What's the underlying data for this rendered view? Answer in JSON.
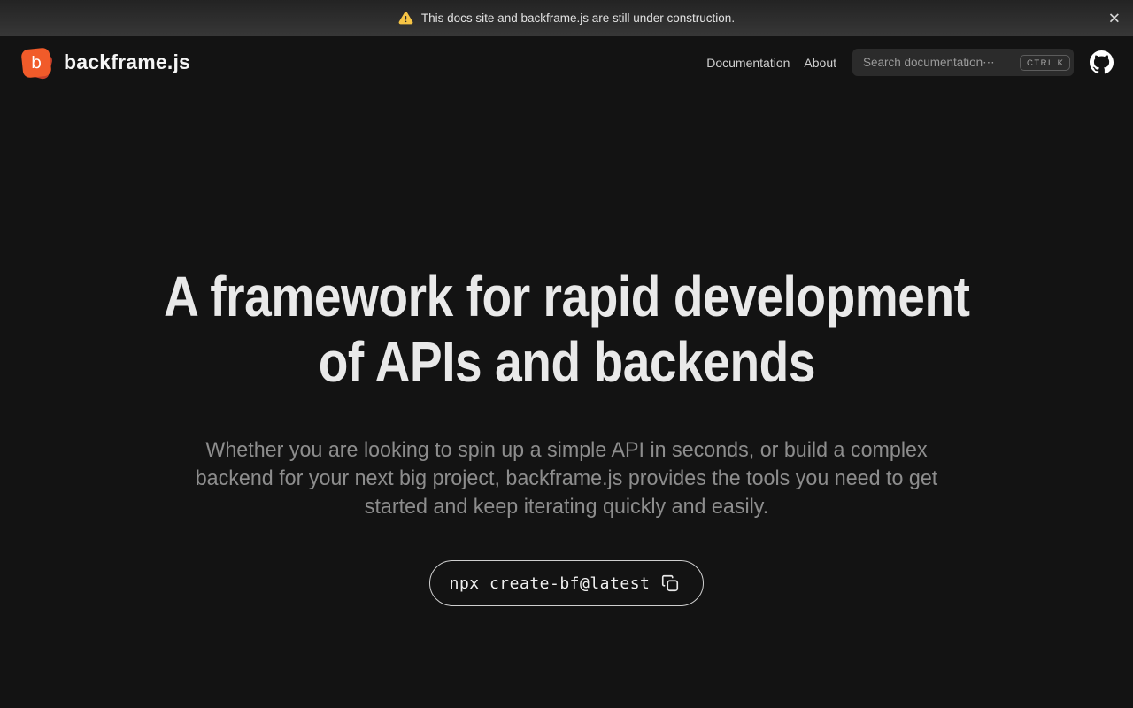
{
  "banner": {
    "text": "This docs site and backframe.js are still under construction.",
    "close_label": "✕"
  },
  "header": {
    "logo_letter": "b",
    "brand": "backframe.js",
    "nav": [
      {
        "label": "Documentation"
      },
      {
        "label": "About"
      }
    ],
    "search": {
      "placeholder": "Search documentation⋯",
      "value": "",
      "shortcut": "CTRL K"
    }
  },
  "hero": {
    "title_line1": "A framework for rapid development",
    "title_line2": "of APIs and backends",
    "subtitle": "Whether you are looking to spin up a simple API in seconds, or build a complex backend for your next big project, backframe.js provides the tools you need to get started and keep iterating quickly and easily.",
    "command": "npx create-bf@latest"
  },
  "icons": {
    "banner_warning": "warning-triangle-icon",
    "banner_close": "close-icon",
    "header_github": "github-icon",
    "command_copy": "copy-icon"
  },
  "colors": {
    "page_background": "#131313",
    "banner_gradient_top": "#232323",
    "banner_gradient_bottom": "#373737",
    "logo_orange": "#f15b2a",
    "logo_dark_orange": "#c8402a",
    "warning_yellow": "#f6c445",
    "heading_text": "#e9e9e9",
    "subtitle_text": "#8d8d8d",
    "header_border": "#2a2a2a",
    "search_background": "#2b2b2b"
  }
}
